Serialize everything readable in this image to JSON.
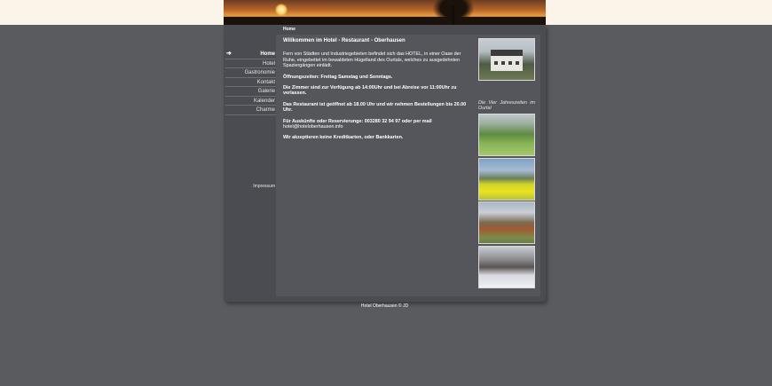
{
  "breadcrumb": "Home",
  "nav": {
    "items": [
      {
        "label": "Home"
      },
      {
        "label": "Hotel"
      },
      {
        "label": "Gastronomie"
      },
      {
        "label": "Kontakt"
      },
      {
        "label": "Galerie"
      },
      {
        "label": "Kalender"
      },
      {
        "label": "Charme"
      }
    ],
    "impressum": "Impressum"
  },
  "content": {
    "title": "Willkommen im Hotel - Restaurant - Oberhausen",
    "intro": "Fern von Städten und Industriegebieten befindet sich das HOTEL, in einer Oase der Ruhe, eingebettet im bewaldeten Hügelland des Ourtals, welches zu ausgedehnten Spaziergängen einlädt.",
    "opening": "Öffnungszeiten: Freitag Samstag und Sonntags.",
    "rooms": "Die Zimmer sind zur Verfügung ab 14:00Uhr und bei Abreise vor 11:00Uhr zu verlassen.",
    "restaurant": "Das Restaurant ist geöffnet ab 18.00 Uhr und wir nehmen Bestellungen bis 20.00 Uhr.",
    "contact_line": "Für Auskünfte oder Reservierunge: 003280 32 94 97 oder per mail",
    "email": "hotel@hoteloberhausen.info",
    "payment": "Wir akzeptieren keine Kreditkarten, oder Bankkarten."
  },
  "side": {
    "caption": "Die Vier Jahreszeiten im Ourtal"
  },
  "footer": "Hotel Oberhausen © JD"
}
